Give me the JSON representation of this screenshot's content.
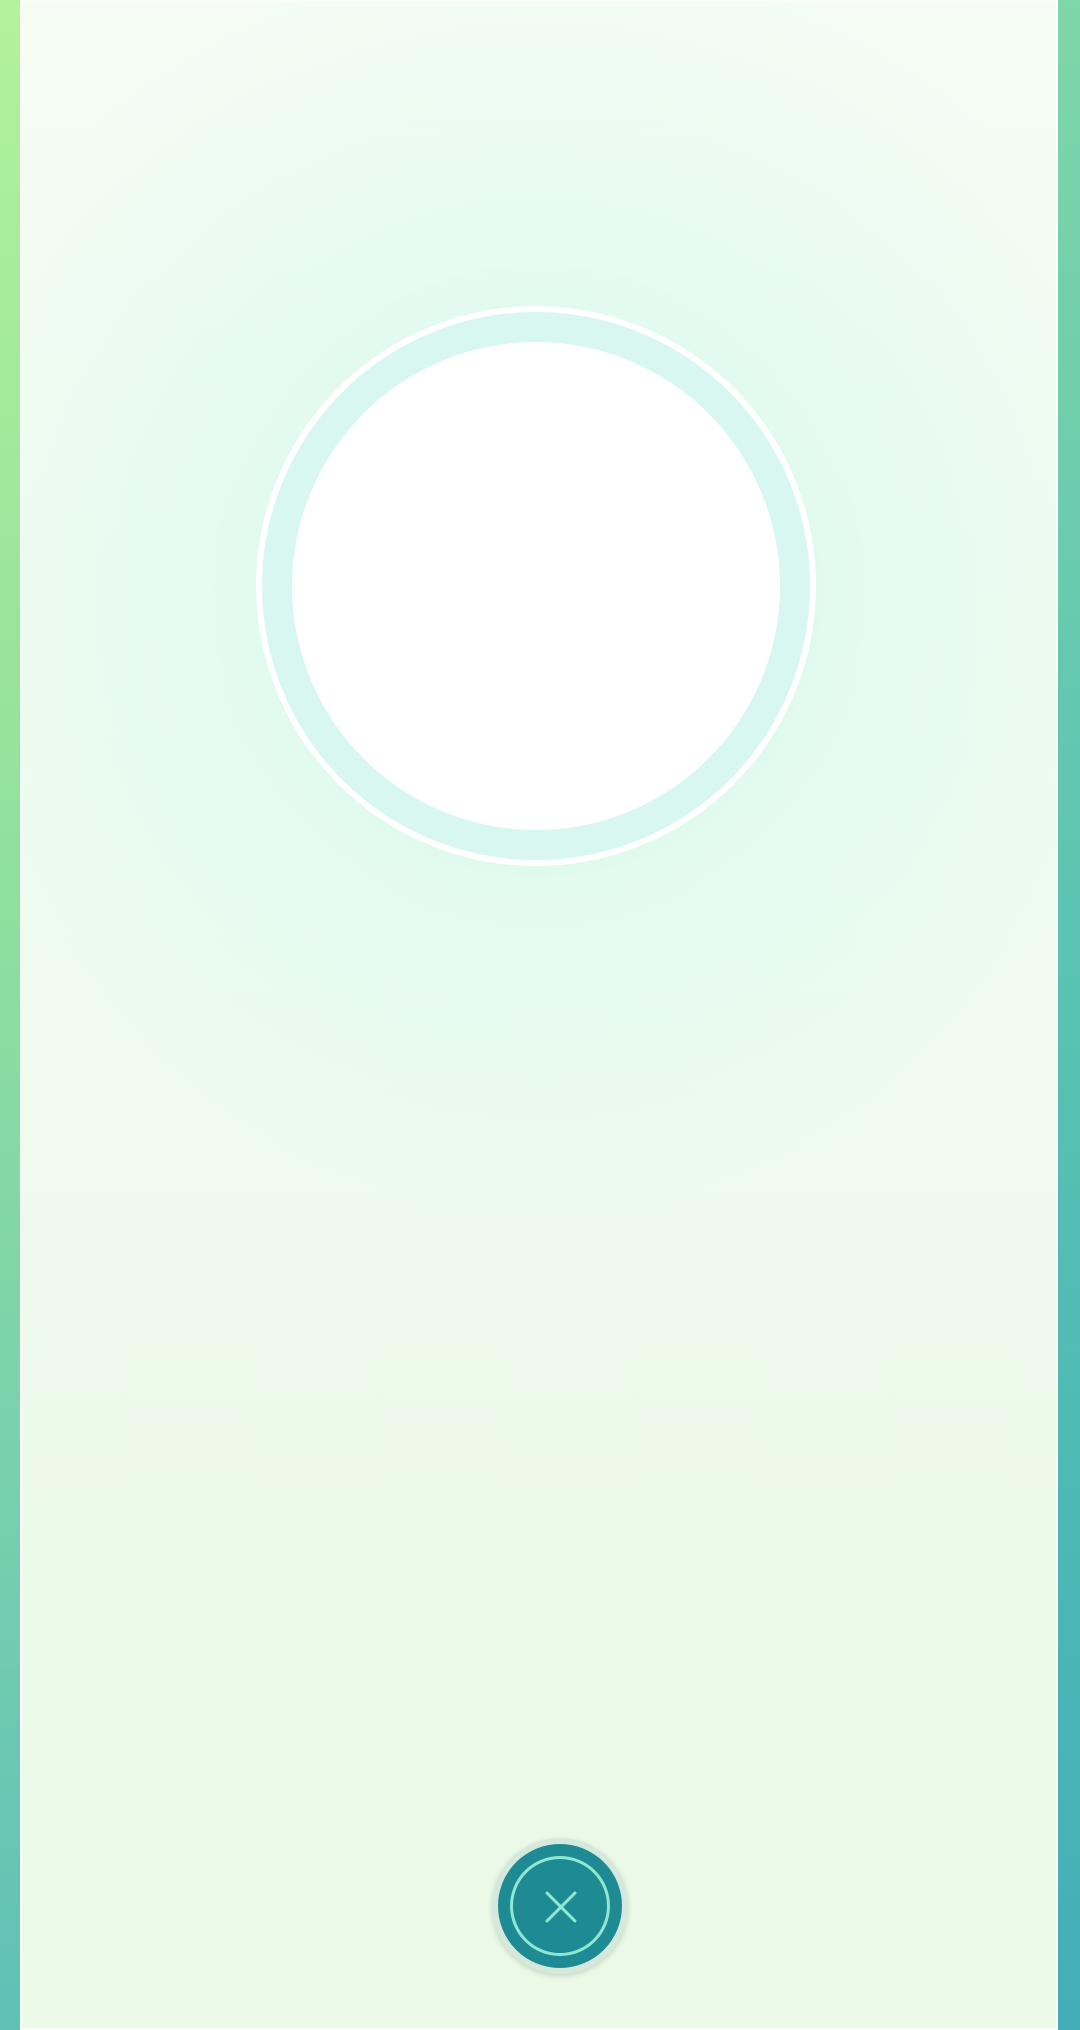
{
  "screen": {
    "accent_color": "#1d8a94",
    "ring_color": "#8fe8cf",
    "panel_color": "#f0fbef"
  },
  "photo": {
    "state": "empty"
  },
  "close_button": {
    "icon": "close-icon"
  }
}
